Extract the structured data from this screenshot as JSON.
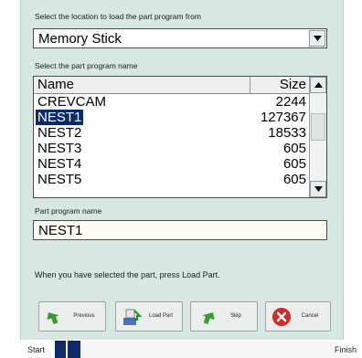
{
  "location": {
    "label": "Select the location to load the part program from",
    "selected": "Memory Stick"
  },
  "list": {
    "label": "Select the part program name",
    "header_name": "Name",
    "header_size": "Size",
    "rows": [
      {
        "name": "CREVCAM",
        "size": "2244"
      },
      {
        "name": "NEST1",
        "size": "127367"
      },
      {
        "name": "NEST2",
        "size": "18533"
      },
      {
        "name": "NEST3",
        "size": "605"
      },
      {
        "name": "NEST4",
        "size": "605"
      },
      {
        "name": "NEST5",
        "size": "605"
      }
    ],
    "selected_index": 1
  },
  "program_name": {
    "label": "Part program name",
    "value": "NEST1"
  },
  "instruction": "When you have selected the part, press Load Part.",
  "buttons": {
    "previous": "Previous",
    "load_part": "Load Part",
    "skip": "Skip",
    "cancel": "Cancel"
  },
  "progress": {
    "start_label": "Start",
    "finish_label": "Finish",
    "fraction": 0.09
  },
  "colors": {
    "panel": "#d7e7e2",
    "selection": "#0a2a6e",
    "progress_fill": "#0f2a6a"
  }
}
